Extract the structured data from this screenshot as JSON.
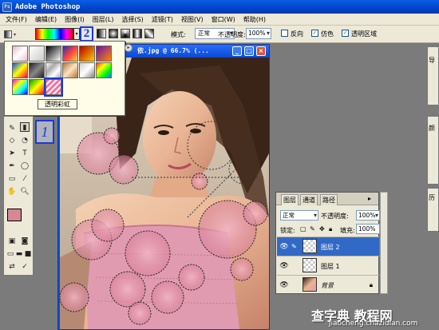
{
  "app": {
    "title": "Adobe Photoshop",
    "icon": "photoshop-app-icon"
  },
  "menu": [
    "文件(F)",
    "编辑(E)",
    "图像(I)",
    "图层(L)",
    "选择(S)",
    "滤镜(T)",
    "视图(V)",
    "窗口(W)",
    "帮助(H)"
  ],
  "options": {
    "mode_label": "模式:",
    "mode_value": "正常",
    "opacity_label": "不透明度:",
    "opacity_value": "100%",
    "reverse_label": "反向",
    "reverse_checked": false,
    "dither_label": "仿色",
    "dither_checked": true,
    "transparency_label": "透明区域",
    "transparency_checked": true
  },
  "annotations": {
    "one": "1",
    "two": "2"
  },
  "gradient_picker": {
    "caption": "透明彩虹"
  },
  "document": {
    "title": "依.jpg @ 66.7% (..."
  },
  "layers_panel": {
    "tabs": [
      "图层",
      "通道",
      "路径"
    ],
    "mode": "正常",
    "opacity_label": "不透明度:",
    "opacity_value": "100%",
    "lock_label": "锁定:",
    "fill_label": "填充:",
    "fill_value": "100%",
    "layers": [
      {
        "name": "图层 2",
        "selected": true
      },
      {
        "name": "图层 1",
        "selected": false
      },
      {
        "name": "背景",
        "selected": false,
        "locked": true
      }
    ]
  },
  "side_tabs": {
    "nav": "导",
    "color": "颜",
    "history": "历"
  },
  "watermark": {
    "main": "查字典 教程网",
    "sub": "jiaocheng.chazidian.com"
  },
  "colors": {
    "foreground": "#d58796",
    "background": "#ffffff",
    "accent": "#1a3ad6",
    "titlebar": "#0a4ad0",
    "selected_layer": "#3169c6"
  }
}
